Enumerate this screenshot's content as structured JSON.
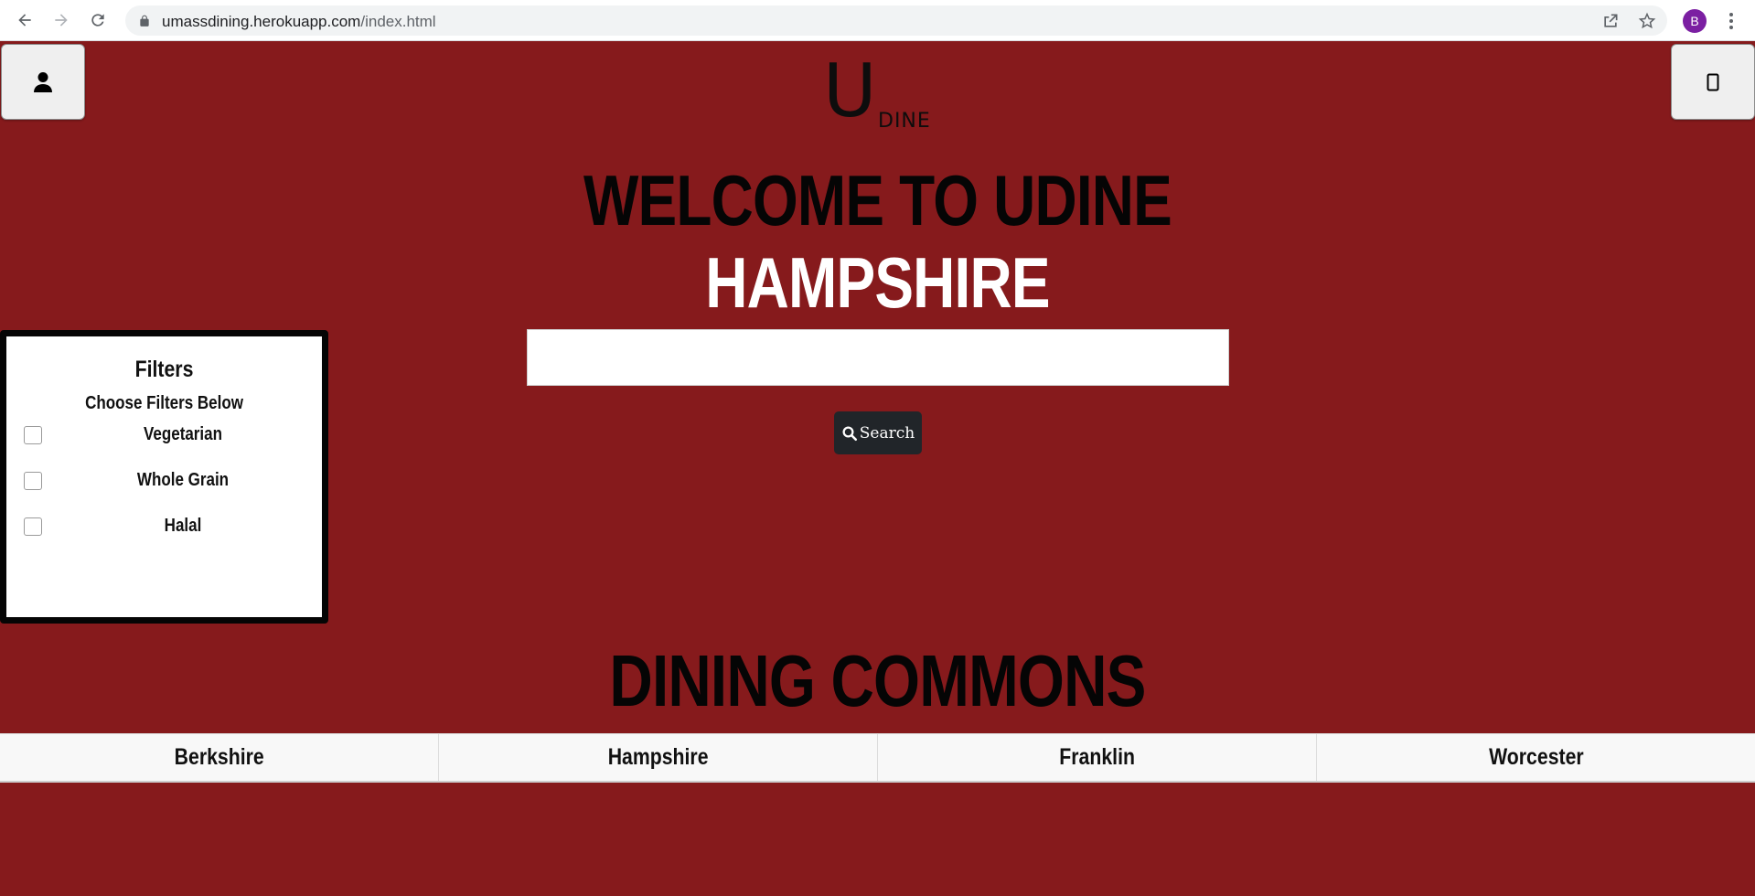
{
  "browser": {
    "url_host": "umassdining.herokuapp.com",
    "url_path": "/index.html",
    "avatar_letter": "B"
  },
  "header": {
    "logo_main": "U",
    "logo_sub": "DINE",
    "welcome": "WELCOME TO UDINE",
    "selected_dc": "HAMPSHIRE"
  },
  "search": {
    "value": "",
    "placeholder": "",
    "button_label": "Search"
  },
  "filters": {
    "title": "Filters",
    "subtitle": "Choose Filters Below",
    "options": [
      {
        "label": "Vegetarian",
        "checked": false
      },
      {
        "label": "Whole Grain",
        "checked": false
      },
      {
        "label": "Halal",
        "checked": false
      }
    ]
  },
  "dining_commons": {
    "title": "DINING COMMONS",
    "tabs": [
      "Berkshire",
      "Hampshire",
      "Franklin",
      "Worcester"
    ]
  },
  "colors": {
    "background": "#861a1c",
    "search_button": "#212529",
    "avatar": "#7b1fa2"
  }
}
